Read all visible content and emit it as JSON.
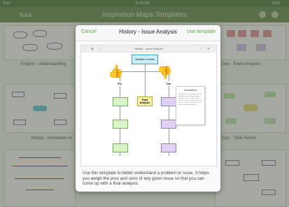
{
  "status": {
    "carrier": "iPad",
    "time": "11:28 AM",
    "battery": "100%"
  },
  "nav": {
    "back_label": "Back",
    "title": "Inspiration Maps Templates"
  },
  "tiles": [
    {
      "label": "English - Understanding"
    },
    {
      "label": "tory - Event Analysis"
    },
    {
      "label": "History - Innovation Ar"
    },
    {
      "label": "tory - Time Period"
    }
  ],
  "modal": {
    "cancel_label": "Cancel",
    "title": "History - Issue Analysis",
    "use_label": "Use template",
    "preview_title": "History - Issue Analysis",
    "nodes": {
      "question": "Question or Issue",
      "pro": "Pro",
      "con": "Con",
      "final": "Final Analysis"
    },
    "instructions_title": "Instructions",
    "instructions_text": "Identify an issue and then use this template to weigh the pros and cons of the issue. Then review each pro and con and make a final analysis of the issue based on the information in the diagram.",
    "description": "Use this template to better understand a problem or issue. It helps you weigh the pros and cons of any given issue so that you can come up with a final analysis."
  },
  "colors": {
    "accent": "#5aa847",
    "question_fill": "#cdeefa",
    "pro_fill": "#d6f5c2",
    "final_fill": "#f7f0a8",
    "con_fill": "#e0d2f5"
  }
}
